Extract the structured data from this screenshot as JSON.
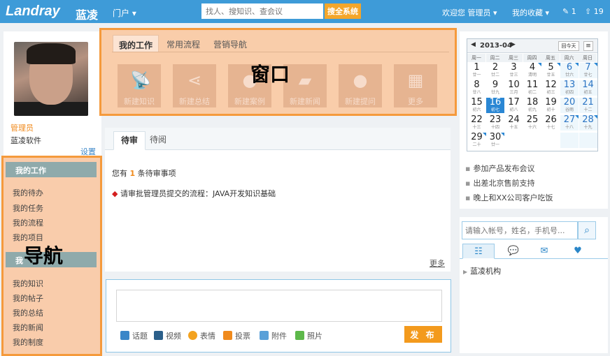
{
  "header": {
    "logo_text": "Landray",
    "logo_cn": "蓝凌",
    "portal_menu": "门户 ▾",
    "search_placeholder": "找人、搜知识、查会议",
    "search_button": "搜全系统",
    "welcome": "欢迎您 管理员 ▾",
    "favorites": "我的收藏 ▾",
    "notes_count": "1",
    "followers_count": "19"
  },
  "profile": {
    "role": "管理员",
    "company": "蓝凌软件",
    "settings": "设置"
  },
  "nav": {
    "overlay_label": "导航",
    "section1_header": "我的工作",
    "section1_items": [
      "我的待办",
      "我的任务",
      "我的流程",
      "我的项目"
    ],
    "section2_header": "我",
    "section2_items": [
      "我的知识",
      "我的帖子",
      "我的总结",
      "我的新闻",
      "我的制度"
    ]
  },
  "window": {
    "overlay_label": "窗口",
    "tabs": [
      "我的工作",
      "常用流程",
      "营销导航"
    ],
    "tiles": [
      {
        "icon": "satellite-dish-icon",
        "label": "新建知识"
      },
      {
        "icon": "share-icon",
        "label": "新建总结"
      },
      {
        "icon": "person-case-icon",
        "label": "新建案例"
      },
      {
        "icon": "car-icon",
        "label": "新建新闻"
      },
      {
        "icon": "person-icon",
        "label": "新建提问"
      },
      {
        "icon": "grid-icon",
        "label": "更多"
      }
    ]
  },
  "review": {
    "tabs": [
      "待审",
      "待阅"
    ],
    "count_prefix": "您有",
    "count": "1",
    "count_suffix": "条待审事项",
    "task_text": "请审批管理员提交的流程：JAVA开发知识基础",
    "more": "更多"
  },
  "post": {
    "tools": [
      "话题",
      "视频",
      "表情",
      "投票",
      "附件",
      "照片"
    ],
    "publish": "发 布"
  },
  "calendar": {
    "month_label": "2013-04",
    "today_button": "回今天",
    "weekdays": [
      "周一",
      "周二",
      "周三",
      "周四",
      "周五",
      "周六",
      "周日"
    ],
    "days": [
      {
        "d": "1",
        "l": "廿一"
      },
      {
        "d": "2",
        "l": "廿二"
      },
      {
        "d": "3",
        "l": "廿三"
      },
      {
        "d": "4",
        "l": "清明"
      },
      {
        "d": "5",
        "l": "廿五"
      },
      {
        "d": "6",
        "l": "廿六"
      },
      {
        "d": "7",
        "l": "廿七"
      },
      {
        "d": "8",
        "l": "廿八"
      },
      {
        "d": "9",
        "l": "廿九"
      },
      {
        "d": "10",
        "l": "三月"
      },
      {
        "d": "11",
        "l": "初二"
      },
      {
        "d": "12",
        "l": "初三"
      },
      {
        "d": "13",
        "l": "初四"
      },
      {
        "d": "14",
        "l": "初五"
      },
      {
        "d": "15",
        "l": "初六"
      },
      {
        "d": "16",
        "l": "初七"
      },
      {
        "d": "17",
        "l": "初八"
      },
      {
        "d": "18",
        "l": "初九"
      },
      {
        "d": "19",
        "l": "初十"
      },
      {
        "d": "20",
        "l": "谷雨"
      },
      {
        "d": "21",
        "l": "十二"
      },
      {
        "d": "22",
        "l": "十三"
      },
      {
        "d": "23",
        "l": "十四"
      },
      {
        "d": "24",
        "l": "十五"
      },
      {
        "d": "25",
        "l": "十六"
      },
      {
        "d": "26",
        "l": "十七"
      },
      {
        "d": "27",
        "l": "十八"
      },
      {
        "d": "28",
        "l": "十九"
      },
      {
        "d": "29",
        "l": "二十"
      },
      {
        "d": "30",
        "l": "廿一"
      }
    ],
    "today": "16",
    "marked_days": [
      "4",
      "5",
      "6",
      "7",
      "16",
      "27",
      "28",
      "29",
      "30"
    ]
  },
  "events": [
    "参加产品发布会议",
    "出差北京售前支持",
    "晚上和XX公司客户吃饭"
  ],
  "org": {
    "search_placeholder": "请输入帐号，姓名，手机号...",
    "root": "蓝凌机构"
  },
  "colors": {
    "topbar": "#3e9bd8",
    "highlight_fill": "#f9ccab",
    "highlight_border": "#f59a3c",
    "accent_orange": "#f39a1d"
  }
}
